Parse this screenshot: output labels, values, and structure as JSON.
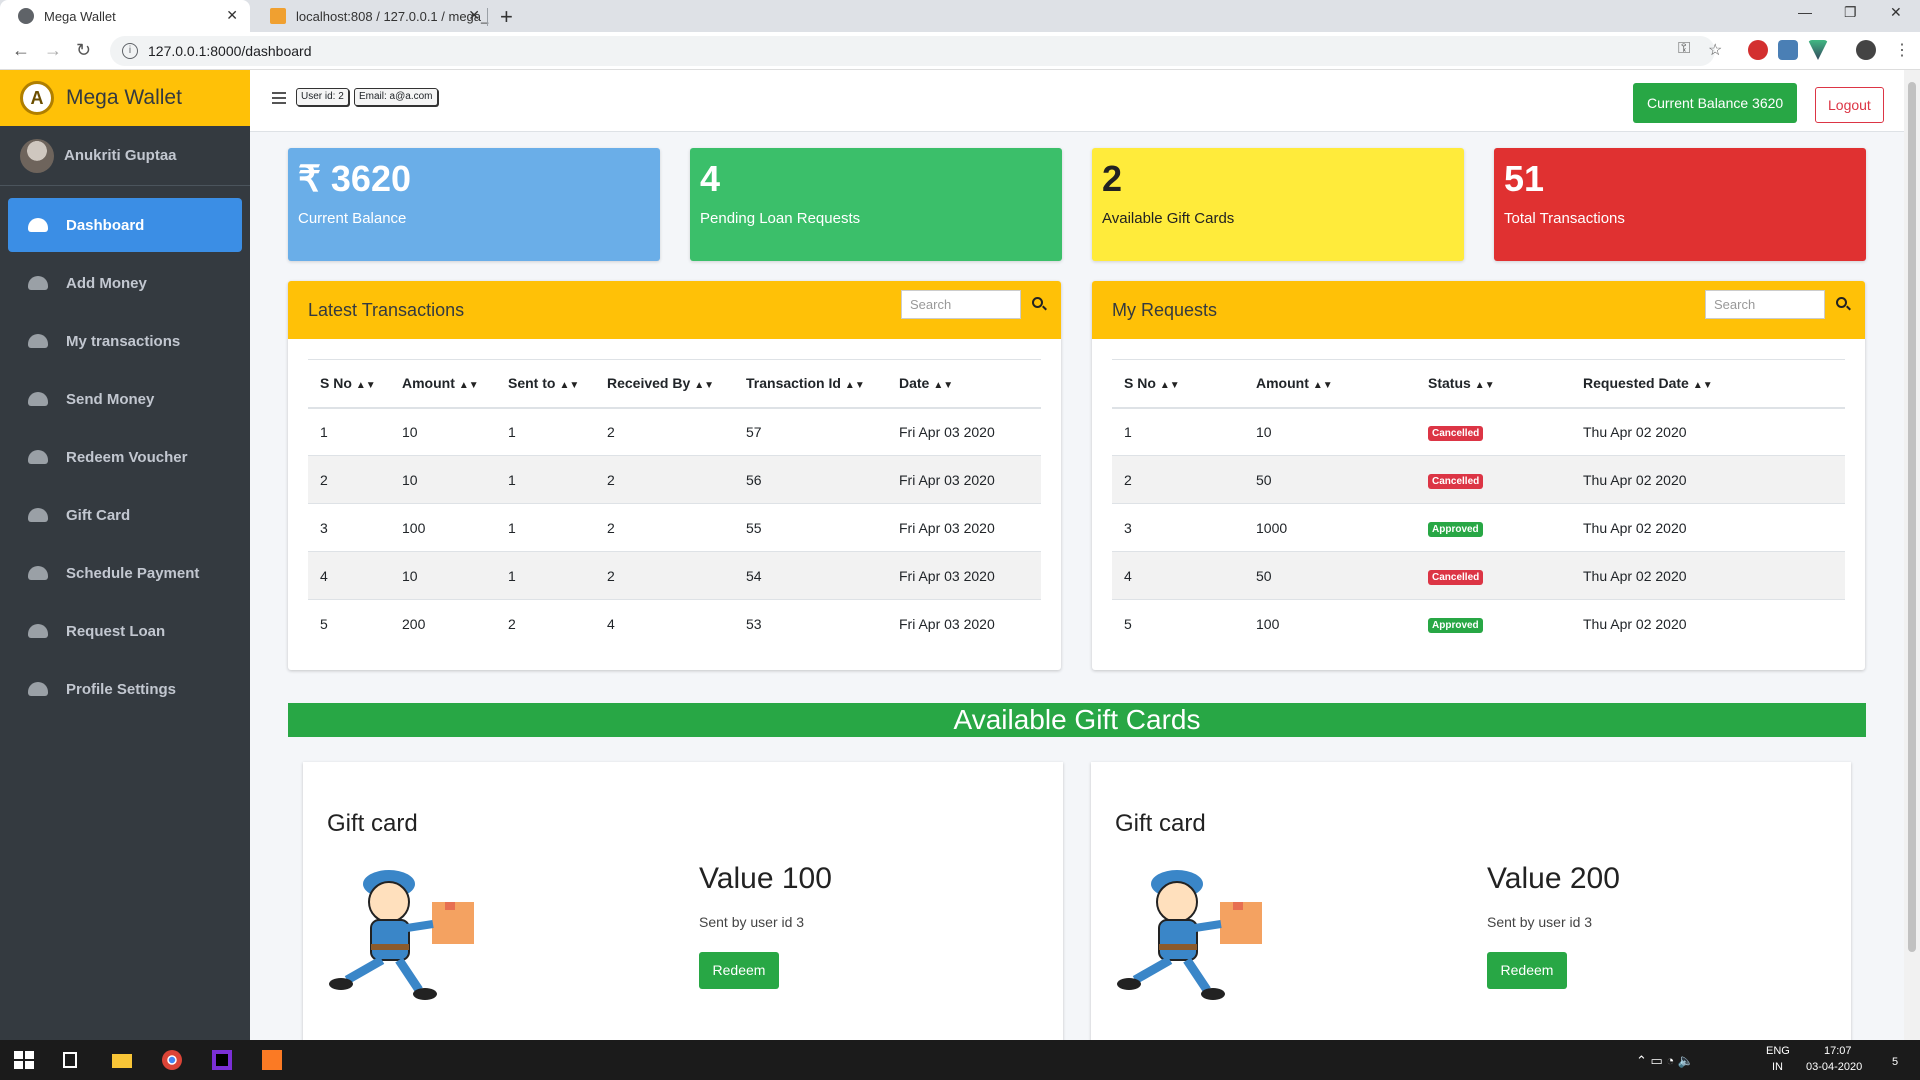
{
  "browser": {
    "tabs": [
      {
        "title": "Mega Wallet",
        "active": true
      },
      {
        "title": "localhost:808 / 127.0.0.1 / mega_",
        "active": false
      }
    ],
    "url": "127.0.0.1:8000/dashboard"
  },
  "sidebar": {
    "brand": "Mega Wallet",
    "brand_logo": "A",
    "user_name": "Anukriti Guptaa",
    "items": [
      {
        "label": "Dashboard",
        "icon": "dashboard-icon",
        "active": true
      },
      {
        "label": "Add Money",
        "icon": "dashboard-icon"
      },
      {
        "label": "My transactions",
        "icon": "dashboard-icon"
      },
      {
        "label": "Send Money",
        "icon": "dashboard-icon"
      },
      {
        "label": "Redeem Voucher",
        "icon": "dashboard-icon"
      },
      {
        "label": "Gift Card",
        "icon": "dashboard-icon"
      },
      {
        "label": "Schedule Payment",
        "icon": "dashboard-icon"
      },
      {
        "label": "Request Loan",
        "icon": "dashboard-icon"
      },
      {
        "label": "Profile Settings",
        "icon": "dashboard-icon"
      }
    ]
  },
  "header": {
    "user_id_chip": "User id: 2",
    "email_chip": "Email: a@a.com",
    "balance_button": "Current Balance 3620",
    "logout_button": "Logout"
  },
  "stats": [
    {
      "value": "₹ 3620",
      "label": "Current Balance",
      "color": "#6aaee8"
    },
    {
      "value": "4",
      "label": "Pending Loan Requests",
      "color": "#3bbf6a"
    },
    {
      "value": "2",
      "label": "Available Gift Cards",
      "color": "#ffeb3b"
    },
    {
      "value": "51",
      "label": "Total Transactions",
      "color": "#e03131"
    }
  ],
  "transactions": {
    "title": "Latest Transactions",
    "search_placeholder": "Search",
    "columns": [
      "S No",
      "Amount",
      "Sent to",
      "Received By",
      "Transaction Id",
      "Date"
    ],
    "rows": [
      [
        "1",
        "10",
        "1",
        "2",
        "57",
        "Fri Apr 03 2020"
      ],
      [
        "2",
        "10",
        "1",
        "2",
        "56",
        "Fri Apr 03 2020"
      ],
      [
        "3",
        "100",
        "1",
        "2",
        "55",
        "Fri Apr 03 2020"
      ],
      [
        "4",
        "10",
        "1",
        "2",
        "54",
        "Fri Apr 03 2020"
      ],
      [
        "5",
        "200",
        "2",
        "4",
        "53",
        "Fri Apr 03 2020"
      ]
    ]
  },
  "requests": {
    "title": "My Requests",
    "search_placeholder": "Search",
    "columns": [
      "S No",
      "Amount",
      "Status",
      "Requested Date"
    ],
    "rows": [
      [
        "1",
        "10",
        "Cancelled",
        "Thu Apr 02 2020"
      ],
      [
        "2",
        "50",
        "Cancelled",
        "Thu Apr 02 2020"
      ],
      [
        "3",
        "1000",
        "Approved",
        "Thu Apr 02 2020"
      ],
      [
        "4",
        "50",
        "Cancelled",
        "Thu Apr 02 2020"
      ],
      [
        "5",
        "100",
        "Approved",
        "Thu Apr 02 2020"
      ]
    ]
  },
  "gift_section": {
    "banner": "Available Gift Cards",
    "cards": [
      {
        "title": "Gift card",
        "value": "Value 100",
        "sender": "Sent by user id 3",
        "button": "Redeem"
      },
      {
        "title": "Gift card",
        "value": "Value 200",
        "sender": "Sent by user id 3",
        "button": "Redeem"
      }
    ]
  },
  "taskbar": {
    "lang_top": "ENG",
    "lang_bottom": "IN",
    "time": "17:07",
    "date": "03-04-2020",
    "notifications": "5"
  }
}
